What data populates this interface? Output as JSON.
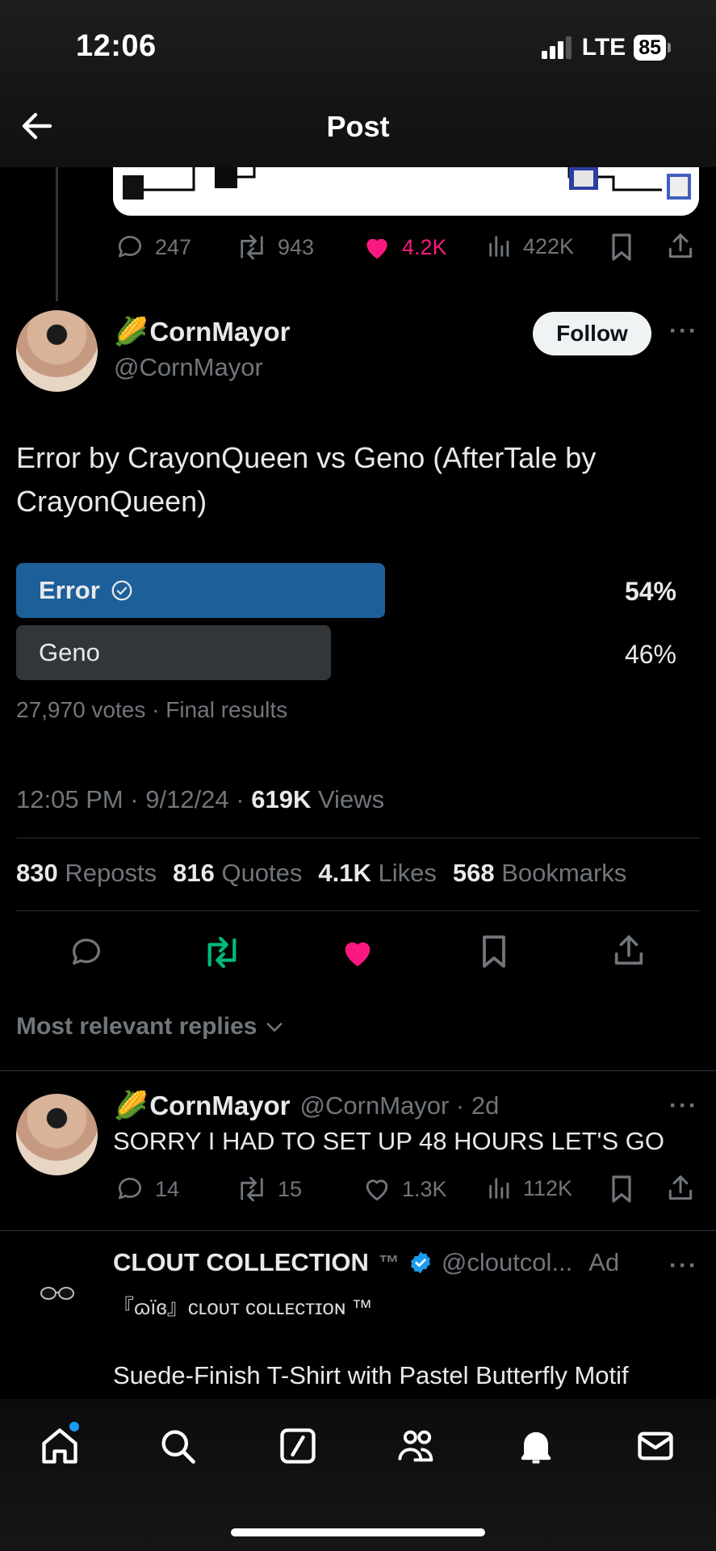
{
  "status_bar": {
    "time": "12:06",
    "network": "LTE",
    "battery": "85"
  },
  "header": {
    "title": "Post"
  },
  "prev_post_actions": {
    "replies": "247",
    "reposts": "943",
    "likes": "4.2K",
    "views": "422K"
  },
  "author": {
    "emoji": "🌽",
    "name": "CornMayor",
    "handle": "@CornMayor",
    "follow_label": "Follow"
  },
  "tweet": {
    "text": "Error by CrayonQueen vs Geno (AfterTale by CrayonQueen)"
  },
  "poll": {
    "options": [
      {
        "label": "Error",
        "percent_label": "54%",
        "percent": 54,
        "winner": true
      },
      {
        "label": "Geno",
        "percent_label": "46%",
        "percent": 46,
        "winner": false
      }
    ],
    "meta": "27,970 votes · Final results"
  },
  "meta": {
    "time": "12:05 PM · 9/12/24 · ",
    "views_count": "619K",
    "views_label": " Views"
  },
  "stats": {
    "reposts_count": "830",
    "reposts_label": "Reposts",
    "quotes_count": "816",
    "quotes_label": "Quotes",
    "likes_count": "4.1K",
    "likes_label": "Likes",
    "bookmarks_count": "568",
    "bookmarks_label": "Bookmarks"
  },
  "replies_sort": {
    "label": "Most relevant replies"
  },
  "reply": {
    "name": "CornMayor",
    "handle_time": "@CornMayor · 2d",
    "text": "SORRY I HAD TO SET UP 48 HOURS LET'S GO",
    "replies": "14",
    "reposts": "15",
    "likes": "1.3K",
    "views": "112K"
  },
  "ad": {
    "name": "CLOUT COLLECTION",
    "tm": "™",
    "handle": "@cloutcol...",
    "ad_label": "Ad",
    "subtitle": "『ɷïɞ』ᴄʟᴏᴜᴛ ᴄᴏʟʟᴇᴄᴛɪᴏɴ ™",
    "text": "Suede-Finish T-Shirt with Pastel Butterfly Motif",
    "avatar_icon": "sunglasses-icon"
  },
  "colors": {
    "like": "#f91880",
    "repost": "#00ba7c",
    "poll_winner": "#1d5f99",
    "verified": "#1d9bf0"
  }
}
